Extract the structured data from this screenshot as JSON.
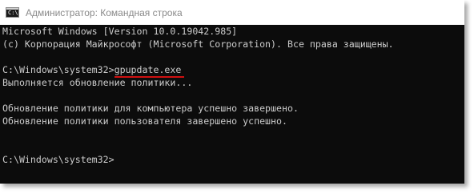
{
  "window": {
    "title": "Администратор: Командная строка",
    "icon_label": "C:\\"
  },
  "console": {
    "lines": [
      "Microsoft Windows [Version 10.0.19042.985]",
      "(c) Корпорация Майкрософт (Microsoft Corporation). Все права защищены.",
      "",
      "",
      "Выполняется обновление политики...",
      "",
      "Обновление политики для компьютера успешно завершено.",
      "Обновление политики пользователя завершено успешно.",
      "",
      "",
      "C:\\Windows\\system32>"
    ],
    "prompt": "C:\\Windows\\system32>",
    "command": "gpupdate.exe"
  },
  "colors": {
    "console_background": "#0c0c0c",
    "console_text": "#cccccc",
    "title_text": "#8a8a8a",
    "underline": "#d01010"
  }
}
